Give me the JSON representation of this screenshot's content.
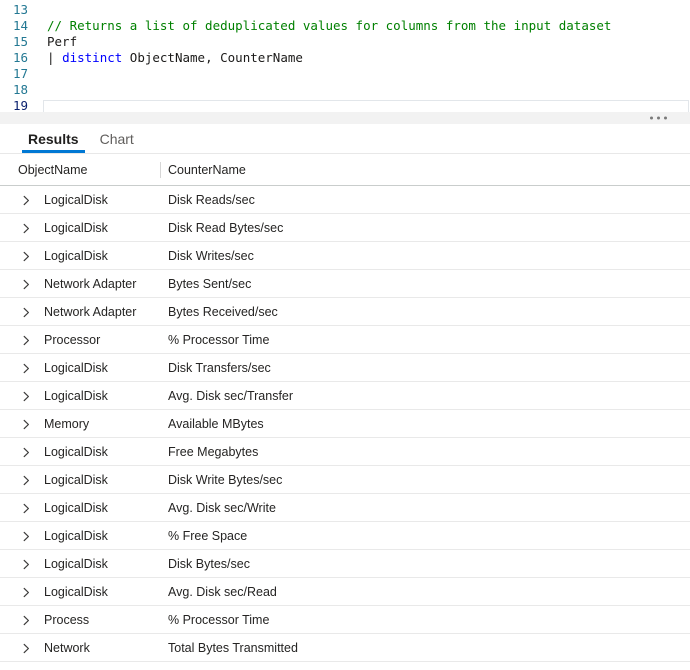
{
  "editor": {
    "lines": [
      {
        "num": "13",
        "segments": []
      },
      {
        "num": "14",
        "segments": [
          {
            "t": "comment",
            "text": "// Returns a list of deduplicated values for columns from the input dataset"
          }
        ]
      },
      {
        "num": "15",
        "segments": [
          {
            "t": "plain",
            "text": "Perf"
          }
        ]
      },
      {
        "num": "16",
        "segments": [
          {
            "t": "plain",
            "text": "| "
          },
          {
            "t": "keyword",
            "text": "distinct"
          },
          {
            "t": "plain",
            "text": " ObjectName, CounterName"
          }
        ]
      },
      {
        "num": "17",
        "segments": []
      },
      {
        "num": "18",
        "segments": []
      },
      {
        "num": "19",
        "segments": [],
        "current": true
      }
    ]
  },
  "icons": {
    "grip_dots": "⋯",
    "expand_chevron": "›"
  },
  "tabs": [
    {
      "label": "Results",
      "active": true
    },
    {
      "label": "Chart",
      "active": false
    }
  ],
  "table": {
    "columns": [
      "ObjectName",
      "CounterName"
    ],
    "rows": [
      [
        "LogicalDisk",
        "Disk Reads/sec"
      ],
      [
        "LogicalDisk",
        "Disk Read Bytes/sec"
      ],
      [
        "LogicalDisk",
        "Disk Writes/sec"
      ],
      [
        "Network Adapter",
        "Bytes Sent/sec"
      ],
      [
        "Network Adapter",
        "Bytes Received/sec"
      ],
      [
        "Processor",
        "% Processor Time"
      ],
      [
        "LogicalDisk",
        "Disk Transfers/sec"
      ],
      [
        "LogicalDisk",
        "Avg. Disk sec/Transfer"
      ],
      [
        "Memory",
        "Available MBytes"
      ],
      [
        "LogicalDisk",
        "Free Megabytes"
      ],
      [
        "LogicalDisk",
        "Disk Write Bytes/sec"
      ],
      [
        "LogicalDisk",
        "Avg. Disk sec/Write"
      ],
      [
        "LogicalDisk",
        "% Free Space"
      ],
      [
        "LogicalDisk",
        "Disk Bytes/sec"
      ],
      [
        "LogicalDisk",
        "Avg. Disk sec/Read"
      ],
      [
        "Process",
        "% Processor Time"
      ],
      [
        "Network",
        "Total Bytes Transmitted"
      ]
    ]
  },
  "colors": {
    "accent": "#0078d4",
    "comment-green": "#008000",
    "keyword-blue": "#0000ff",
    "code-text": "#1b1a19",
    "line-number": "#237893",
    "active-line-number": "#0b216f",
    "tab-active-text": "#201f1e",
    "tab-inactive": "#605e5c",
    "table-text": "#252423",
    "row-divider": "#e9e9e9",
    "header-divider": "#c9cdcc"
  }
}
